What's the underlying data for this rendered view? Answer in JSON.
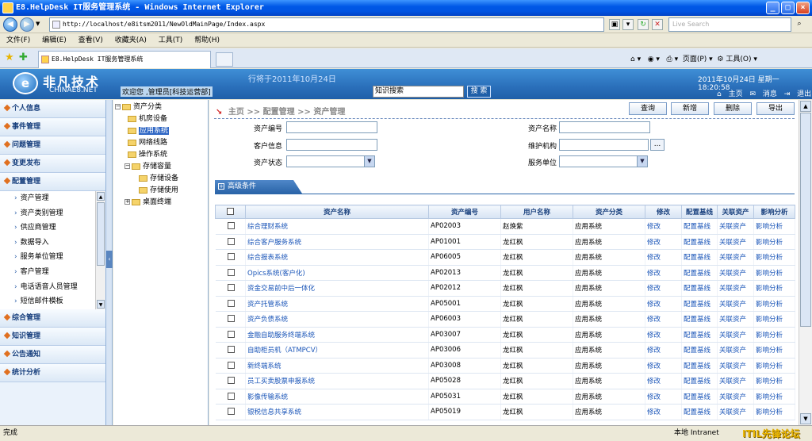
{
  "window": {
    "title": "E8.HelpDesk IT服务管理系统 - Windows Internet Explorer"
  },
  "browser": {
    "url": "http://localhost/e8itsm2011/NewOldMainPage/Index.aspx",
    "search_placeholder": "Live Search",
    "menu": [
      "文件(F)",
      "编辑(E)",
      "查看(V)",
      "收藏夹(A)",
      "工具(T)",
      "帮助(H)"
    ],
    "tab_title": "E8.HelpDesk IT服务管理系统",
    "tools": {
      "page": "页面(P)",
      "tools": "工具(O)"
    }
  },
  "header": {
    "logo_mark": "e",
    "logo_text": "非凡技术",
    "logo_sub": "CHINAE8.NET",
    "welcome": "欢迎您 ,管理员[科技运营部]",
    "marquee": "行将于2011年10月24日",
    "search_value": "知识搜索",
    "search_button": "搜 索",
    "date": "2011年10月24日  星期一  18:20:58",
    "links": [
      "主页",
      "消息",
      "退出"
    ]
  },
  "nav": {
    "sections_top": [
      "个人信息",
      "事件管理",
      "问题管理",
      "变更发布",
      "配置管理"
    ],
    "sub_items": [
      "资产管理",
      "资产类别管理",
      "供应商管理",
      "数据导入",
      "服务单位管理",
      "客户管理",
      "电话语音人员管理",
      "短信邮件模板"
    ],
    "sections_bottom": [
      "综合管理",
      "知识管理",
      "公告通知",
      "统计分析"
    ]
  },
  "tree": {
    "root": "资产分类",
    "items": [
      "机房设备",
      "应用系统",
      "网络线路",
      "操作系统",
      "存储容量",
      "存储设备",
      "存储使用",
      "桌面终端"
    ]
  },
  "main": {
    "breadcrumb": {
      "home": "主页",
      "level1": ">> 配置管理",
      "level2": ">> 资产管理"
    },
    "buttons": {
      "query": "查询",
      "add": "新增",
      "delete": "删除",
      "export": "导出"
    },
    "form": {
      "asset_no": "资产编号",
      "asset_name": "资产名称",
      "customer": "客户信息",
      "maint_org": "维护机构",
      "asset_status": "资产状态",
      "service_unit": "服务单位",
      "browse_button": "..."
    },
    "advanced": "高级条件",
    "table": {
      "headers": [
        "资产名称",
        "资产编号",
        "用户名称",
        "资产分类",
        "修改",
        "配置基线",
        "关联资产",
        "影响分析"
      ],
      "rows": [
        [
          "综合理财系统",
          "AP02003",
          "赵焕紫",
          "应用系统",
          "修改",
          "配置基线",
          "关联资产",
          "影响分析"
        ],
        [
          "综合客户服务系统",
          "AP01001",
          "龙红枫",
          "应用系统",
          "修改",
          "配置基线",
          "关联资产",
          "影响分析"
        ],
        [
          "综合报表系统",
          "AP06005",
          "龙红枫",
          "应用系统",
          "修改",
          "配置基线",
          "关联资产",
          "影响分析"
        ],
        [
          "Opics系统(客户化)",
          "AP02013",
          "龙红枫",
          "应用系统",
          "修改",
          "配置基线",
          "关联资产",
          "影响分析"
        ],
        [
          "资金交易前中后一体化",
          "AP02012",
          "龙红枫",
          "应用系统",
          "修改",
          "配置基线",
          "关联资产",
          "影响分析"
        ],
        [
          "资产托管系统",
          "AP05001",
          "龙红枫",
          "应用系统",
          "修改",
          "配置基线",
          "关联资产",
          "影响分析"
        ],
        [
          "资产负债系统",
          "AP06003",
          "龙红枫",
          "应用系统",
          "修改",
          "配置基线",
          "关联资产",
          "影响分析"
        ],
        [
          "金融自助服务终端系统",
          "AP03007",
          "龙红枫",
          "应用系统",
          "修改",
          "配置基线",
          "关联资产",
          "影响分析"
        ],
        [
          "自助柜员机（ATMPCV）",
          "AP03006",
          "龙红枫",
          "应用系统",
          "修改",
          "配置基线",
          "关联资产",
          "影响分析"
        ],
        [
          "新终端系统",
          "AP03008",
          "龙红枫",
          "应用系统",
          "修改",
          "配置基线",
          "关联资产",
          "影响分析"
        ],
        [
          "员工买卖股票申报系统",
          "AP05028",
          "龙红枫",
          "应用系统",
          "修改",
          "配置基线",
          "关联资产",
          "影响分析"
        ],
        [
          "影像传输系统",
          "AP05031",
          "龙红枫",
          "应用系统",
          "修改",
          "配置基线",
          "关联资产",
          "影响分析"
        ],
        [
          "银税信息共享系统",
          "AP05019",
          "龙红枫",
          "应用系统",
          "修改",
          "配置基线",
          "关联资产",
          "影响分析"
        ]
      ]
    }
  },
  "status": {
    "left": "完成",
    "zone": "本地 Intranet",
    "watermark": "ITIL先锋论坛"
  }
}
